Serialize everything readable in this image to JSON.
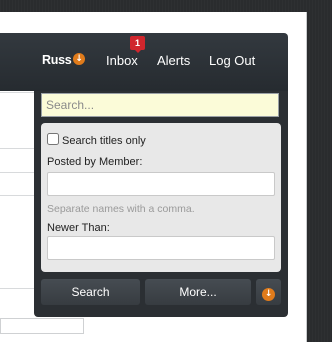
{
  "nav": {
    "user": "Russ",
    "user_menu_icon": "down-arrow-circle-icon",
    "inbox": "Inbox",
    "inbox_badge": "1",
    "alerts": "Alerts",
    "logout": "Log Out"
  },
  "search": {
    "placeholder": "Search...",
    "value": "",
    "titles_only_label": "Search titles only",
    "titles_only_checked": false,
    "posted_by_label": "Posted by Member:",
    "posted_by_value": "",
    "posted_by_hint": "Separate names with a comma.",
    "newer_than_label": "Newer Than:",
    "newer_than_value": "",
    "search_button": "Search",
    "more_button": "More...",
    "options_icon": "down-arrow-circle-icon"
  },
  "colors": {
    "accent": "#e07b1b",
    "badge": "#d0262d",
    "header": "#2b2f33",
    "input_highlight": "#fbfbd8"
  }
}
